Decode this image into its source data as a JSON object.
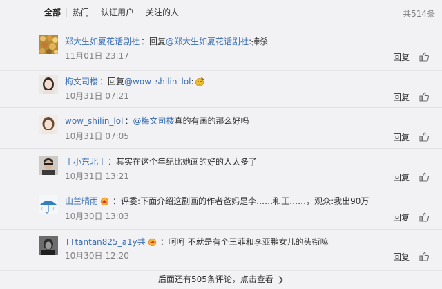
{
  "filter_tabs": [
    "全部",
    "热门",
    "认证用户",
    "关注的人"
  ],
  "total_count": "共514条",
  "comments": [
    {
      "user": "郑大生如夏花话剧社",
      "reply_prefix": "回复",
      "mention": "@郑大生如夏花话剧社",
      "text": ":捧杀",
      "time": "11月01日 23:17"
    },
    {
      "user": "梅文司楼",
      "reply_prefix": "回复",
      "mention": "@wow_shilin_lol",
      "text": ":",
      "time": "10月31日 07:21"
    },
    {
      "user": "wow_shilin_lol",
      "mention": "@梅文司楼",
      "text": " 真的有画的那么好吗",
      "time": "10月31日 07:05"
    },
    {
      "user": "丨小东北丨",
      "text": "其实在这个年纪比她画的好的人太多了",
      "time": "10月31日 13:21"
    },
    {
      "user": "山兰晴雨",
      "text": "评委:下面介绍这副画的作者爸妈是李……和王……，观众:我出90万",
      "time": "10月30日 13:03"
    },
    {
      "user": "TTtantan825_a1y共",
      "text": "呵呵 不就是有个王菲和李亚鹏女儿的头衔嘛",
      "time": "10月30日 12:20"
    }
  ],
  "reply_label": "回复",
  "footer_text": "后面还有505条评论，点击查看",
  "colors": {
    "link": "#3b6fb3",
    "muted": "#808080",
    "background": "#f2f2f5"
  }
}
